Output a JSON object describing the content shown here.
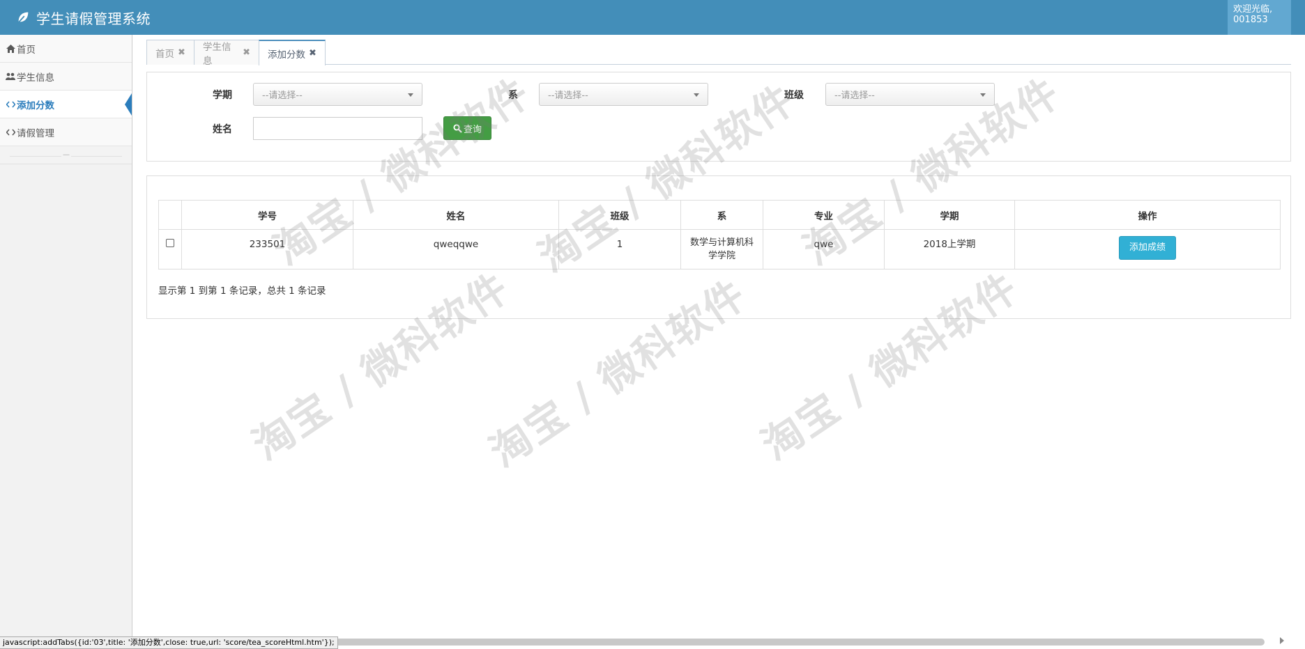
{
  "header": {
    "title": "学生请假管理系统",
    "welcome_line1": "欢迎光临,",
    "welcome_line2": "001853"
  },
  "sidebar": {
    "items": [
      {
        "label": "首页",
        "icon": "home-icon"
      },
      {
        "label": "学生信息",
        "icon": "users-icon"
      },
      {
        "label": "添加分数",
        "icon": "code-icon",
        "active": true
      },
      {
        "label": "请假管理",
        "icon": "code-icon"
      }
    ]
  },
  "tabs": [
    {
      "label": "首页",
      "close": "✖"
    },
    {
      "label": "学生信息",
      "close": "✖"
    },
    {
      "label": "添加分数",
      "close": "✖",
      "active": true
    }
  ],
  "filters": {
    "term_label": "学期",
    "term_value": "--请选择--",
    "dept_label": "系",
    "dept_value": "--请选择--",
    "class_label": "班级",
    "class_value": "--请选择--",
    "name_label": "姓名",
    "name_value": "",
    "search_label": "查询"
  },
  "table": {
    "headers": [
      "",
      "学号",
      "姓名",
      "班级",
      "系",
      "专业",
      "学期",
      "操作"
    ],
    "rows": [
      {
        "checked": false,
        "student_id": "233501",
        "name": "qweqqwe",
        "class": "1",
        "dept_line1": "数学与计算机科",
        "dept_line2": "学学院",
        "major": "qwe",
        "term": "2018上学期",
        "action": "添加成绩"
      }
    ],
    "page_info": "显示第 1 到第 1 条记录，总共 1 条记录"
  },
  "statusbar": {
    "text": "javascript:addTabs({id:'03',title: '添加分数',close: true,url: 'score/tea_scoreHtml.htm'});"
  },
  "watermark": "淘宝 / 微科软件",
  "colors": {
    "header": "#438eb9",
    "user_box": "#62a8d1",
    "active_nav": "#2b7dbc",
    "search_button": "#449d44",
    "info_button": "#31b0d5"
  }
}
